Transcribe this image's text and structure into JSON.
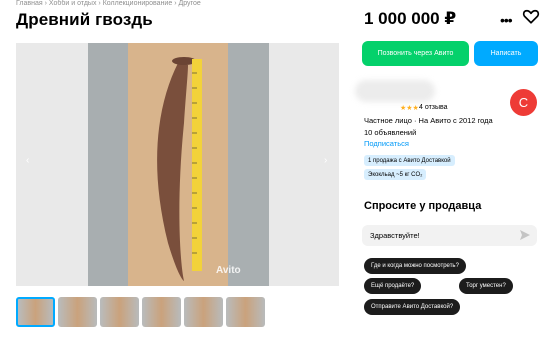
{
  "breadcrumb": [
    "Главная",
    "Хобби и отдых",
    "Коллекционирование",
    "Другое"
  ],
  "breadcrumb_separator": "›",
  "title": "Древний гвоздь",
  "price": "1 000 000 ₽",
  "icons": {
    "more": "more-icon",
    "favorite": "heart-icon",
    "send": "send-icon",
    "prev": "chevron-left-icon",
    "next": "chevron-right-icon"
  },
  "actions": {
    "call": "Позвонить через Авито",
    "write": "Написать"
  },
  "gallery": {
    "watermark": "Avito",
    "arrow_left": "‹",
    "arrow_right": "›",
    "thumb_count": 6,
    "active_thumb": 0
  },
  "seller": {
    "stars": "★★★",
    "reviews": "4 отзыва",
    "info": "Частное лицо · На Авито с 2012 года",
    "ads": "10 объявлений",
    "subscribe": "Подписаться",
    "avatar_letter": "С",
    "avatar_color": "#ee3b36"
  },
  "badges": [
    "1 продажа с Авито Доставкой",
    "Экокльад ~5 кг CO₂"
  ],
  "ask": {
    "title": "Спросите у продавца",
    "input_value": "Здравствуйте!",
    "chips": [
      "Где и когда можно посмотреть?",
      "Ещё продаёте?",
      "Торг уместен?",
      "Отправите Авито Доставкой?"
    ]
  },
  "colors": {
    "green": "#04d16b",
    "blue": "#00aaff",
    "link": "#0099f7"
  }
}
